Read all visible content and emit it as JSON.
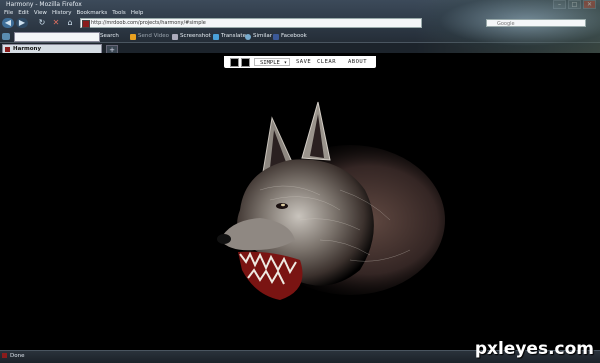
{
  "window": {
    "title": "Harmony - Mozilla Firefox",
    "minimize": "–",
    "maximize": "□",
    "close": "✕"
  },
  "menu": [
    "File",
    "Edit",
    "View",
    "History",
    "Bookmarks",
    "Tools",
    "Help"
  ],
  "nav": {
    "url": "http://mrdoob.com/projects/harmony/#simple",
    "search_placeholder": "Google",
    "back": "◀",
    "forward": "▶",
    "reload": "↻",
    "stop": "✕",
    "home": "⌂"
  },
  "toolbar": {
    "search_label": "Search",
    "send_video": "Send Video",
    "screenshot": "Screenshot",
    "translate": "Translate",
    "similar": "Similar",
    "facebook": "Facebook"
  },
  "tabs": [
    {
      "label": "Harmony"
    }
  ],
  "new_tab": "+",
  "harmony": {
    "brush": "SIMPLE",
    "save": "SAVE",
    "clear": "CLEAR",
    "about": "ABOUT"
  },
  "status": {
    "text": "Done"
  },
  "watermark": "pxleyes.com",
  "colors": {
    "accent": "#8a1c1c",
    "canvas": "#000000"
  }
}
